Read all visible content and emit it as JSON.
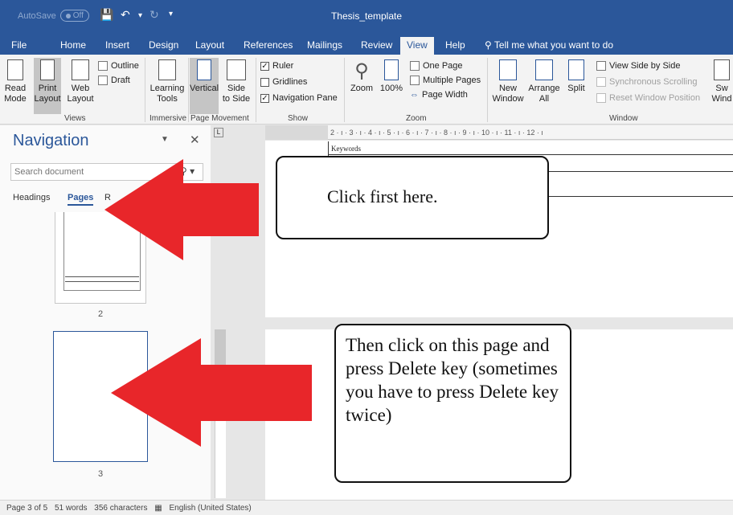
{
  "titlebar": {
    "autosave_label": "AutoSave",
    "autosave_state": "Off",
    "title": "Thesis_template"
  },
  "tabs": [
    "File",
    "Home",
    "Insert",
    "Design",
    "Layout",
    "References",
    "Mailings",
    "Review",
    "View",
    "Help"
  ],
  "active_tab": "View",
  "tell_me": "Tell me what you want to do",
  "ribbon": {
    "views": {
      "label": "Views",
      "read_mode": [
        "Read",
        "Mode"
      ],
      "print_layout": [
        "Print",
        "Layout"
      ],
      "web_layout": [
        "Web",
        "Layout"
      ],
      "outline": "Outline",
      "draft": "Draft"
    },
    "immersive": {
      "label": "Immersive",
      "learning_tools": [
        "Learning",
        "Tools"
      ]
    },
    "page_movement": {
      "label": "Page Movement",
      "vertical": "Vertical",
      "side_to_side": [
        "Side",
        "to Side"
      ]
    },
    "show": {
      "label": "Show",
      "ruler": "Ruler",
      "gridlines": "Gridlines",
      "navigation_pane": "Navigation Pane"
    },
    "zoom": {
      "label": "Zoom",
      "zoom": "Zoom",
      "hundred": "100%",
      "one_page": "One Page",
      "multiple_pages": "Multiple Pages",
      "page_width": "Page Width"
    },
    "window": {
      "label": "Window",
      "new_window": [
        "New",
        "Window"
      ],
      "arrange_all": [
        "Arrange",
        "All"
      ],
      "split": "Split",
      "view_side_by_side": "View Side by Side",
      "synchronous_scrolling": "Synchronous Scrolling",
      "reset_window_position": "Reset Window Position",
      "switch_windows": [
        "Sw",
        "Wind"
      ]
    }
  },
  "navigation": {
    "title": "Navigation",
    "search_placeholder": "Search document",
    "tabs": [
      "Headings",
      "Pages",
      "R"
    ],
    "active_tab": "Pages",
    "pages": [
      "2",
      "3"
    ]
  },
  "ruler_text": "2 · ı · 1 · ı ·     · ı  1 · ı · 2 · ı · 3 · ı · 4 · ı · 5 · ı · 6 · ı · 7 · ı · 8 · ı · 9 · ı · 10 · ı · 11 · ı · 12 · ı",
  "document": {
    "keywords": "Keywords"
  },
  "annotations": {
    "callout1": "Click first here.",
    "callout2": "Then click on this page and press Delete key (sometimes you have to press Delete key twice)",
    "arrow_color": "#e8262a"
  },
  "status": {
    "page": "Page 3 of 5",
    "words": "51 words",
    "characters": "356 characters",
    "language": "English (United States)"
  },
  "colors": {
    "accent": "#2b579a"
  }
}
